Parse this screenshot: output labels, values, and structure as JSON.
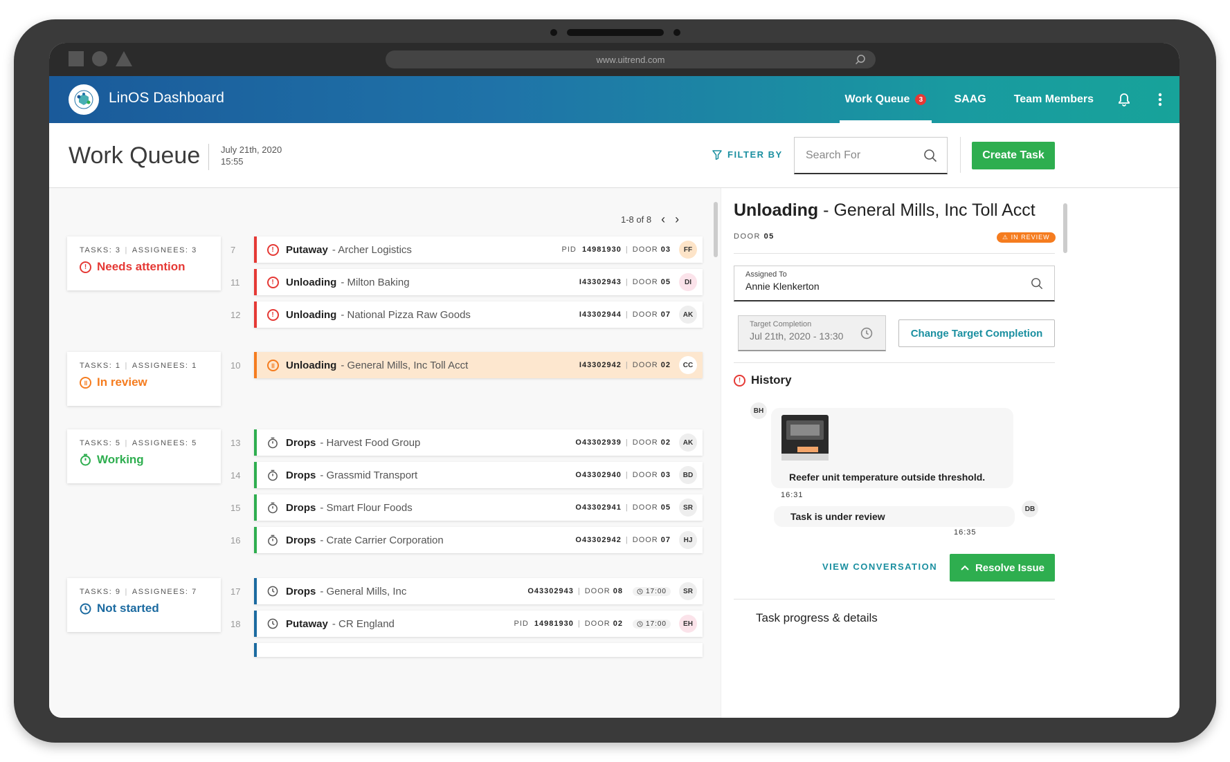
{
  "browser": {
    "url": "www.uitrend.com"
  },
  "app": {
    "title": "LinOS Dashboard"
  },
  "nav": {
    "items": [
      {
        "label": "Work Queue",
        "badge": "3"
      },
      {
        "label": "SAAG"
      },
      {
        "label": "Team Members"
      }
    ]
  },
  "header": {
    "title": "Work Queue",
    "date": "July 21th, 2020",
    "time": "15:55",
    "filter_label": "FILTER BY",
    "search_placeholder": "Search For",
    "create_label": "Create Task"
  },
  "pager": {
    "text": "1-8 of 8"
  },
  "groups": [
    {
      "tasks_label": "TASKS:",
      "tasks": "3",
      "assignees_label": "ASSIGNEES:",
      "assignees": "3",
      "status": "Needs attention",
      "color": "#e53935"
    },
    {
      "tasks_label": "TASKS:",
      "tasks": "1",
      "assignees_label": "ASSIGNEES:",
      "assignees": "1",
      "status": "In review",
      "color": "#f57c1f"
    },
    {
      "tasks_label": "TASKS:",
      "tasks": "5",
      "assignees_label": "ASSIGNEES:",
      "assignees": "5",
      "status": "Working",
      "color": "#2eae4f"
    },
    {
      "tasks_label": "TASKS:",
      "tasks": "9",
      "assignees_label": "ASSIGNEES:",
      "assignees": "7",
      "status": "Not started",
      "color": "#1b6aa0"
    }
  ],
  "tasks": [
    {
      "num": "7",
      "type": "Putaway",
      "client": "- Archer Logistics",
      "pid_label": "PID",
      "id": "14981930",
      "door_label": "DOOR",
      "door": "03",
      "avatar": "FF"
    },
    {
      "num": "11",
      "type": "Unloading",
      "client": "- Milton Baking",
      "id": "I43302943",
      "door_label": "DOOR",
      "door": "05",
      "avatar": "DI"
    },
    {
      "num": "12",
      "type": "Unloading",
      "client": "- National Pizza Raw Goods",
      "id": "I43302944",
      "door_label": "DOOR",
      "door": "07",
      "avatar": "AK"
    },
    {
      "num": "10",
      "type": "Unloading",
      "client": "- General Mills, Inc Toll Acct",
      "id": "I43302942",
      "door_label": "DOOR",
      "door": "02",
      "avatar": "CC"
    },
    {
      "num": "13",
      "type": "Drops",
      "client": "- Harvest Food Group",
      "id": "O43302939",
      "door_label": "DOOR",
      "door": "02",
      "avatar": "AK"
    },
    {
      "num": "14",
      "type": "Drops",
      "client": "- Grassmid Transport",
      "id": "O43302940",
      "door_label": "DOOR",
      "door": "03",
      "avatar": "BD"
    },
    {
      "num": "15",
      "type": "Drops",
      "client": "- Smart Flour Foods",
      "id": "O43302941",
      "door_label": "DOOR",
      "door": "05",
      "avatar": "SR"
    },
    {
      "num": "16",
      "type": "Drops",
      "client": "- Crate Carrier Corporation",
      "id": "O43302942",
      "door_label": "DOOR",
      "door": "07",
      "avatar": "HJ"
    },
    {
      "num": "17",
      "type": "Drops",
      "client": "- General Mills, Inc",
      "id": "O43302943",
      "door_label": "DOOR",
      "door": "08",
      "time": "17:00",
      "avatar": "SR"
    },
    {
      "num": "18",
      "type": "Putaway",
      "client": "- CR England",
      "pid_label": "PID",
      "id": "14981930",
      "door_label": "DOOR",
      "door": "02",
      "time": "17:00",
      "avatar": "EH"
    }
  ],
  "detail": {
    "type": "Unloading",
    "client": "- General Mills, Inc Toll Acct",
    "door_label": "DOOR",
    "door": "05",
    "status": "IN REVIEW",
    "assigned_label": "Assigned To",
    "assigned_value": "Annie Klenkerton",
    "target_label": "Target Completion",
    "target_value": "Jul 21th, 2020 - 13:30",
    "change_label": "Change Target Completion",
    "history_label": "History",
    "messages": [
      {
        "author": "BH",
        "text": "Reefer unit temperature outside threshold.",
        "time": "16:31"
      },
      {
        "author": "DB",
        "text": "Task is under review",
        "time": "16:35"
      }
    ],
    "view_conversation": "VIEW CONVERSATION",
    "resolve_label": "Resolve Issue",
    "progress_label": "Task progress & details"
  },
  "colors": {
    "accent": "#1a8fa0",
    "primary_green": "#2eae4f",
    "alert_red": "#e53935",
    "review_orange": "#f57c1f",
    "notstarted_blue": "#1b6aa0"
  }
}
